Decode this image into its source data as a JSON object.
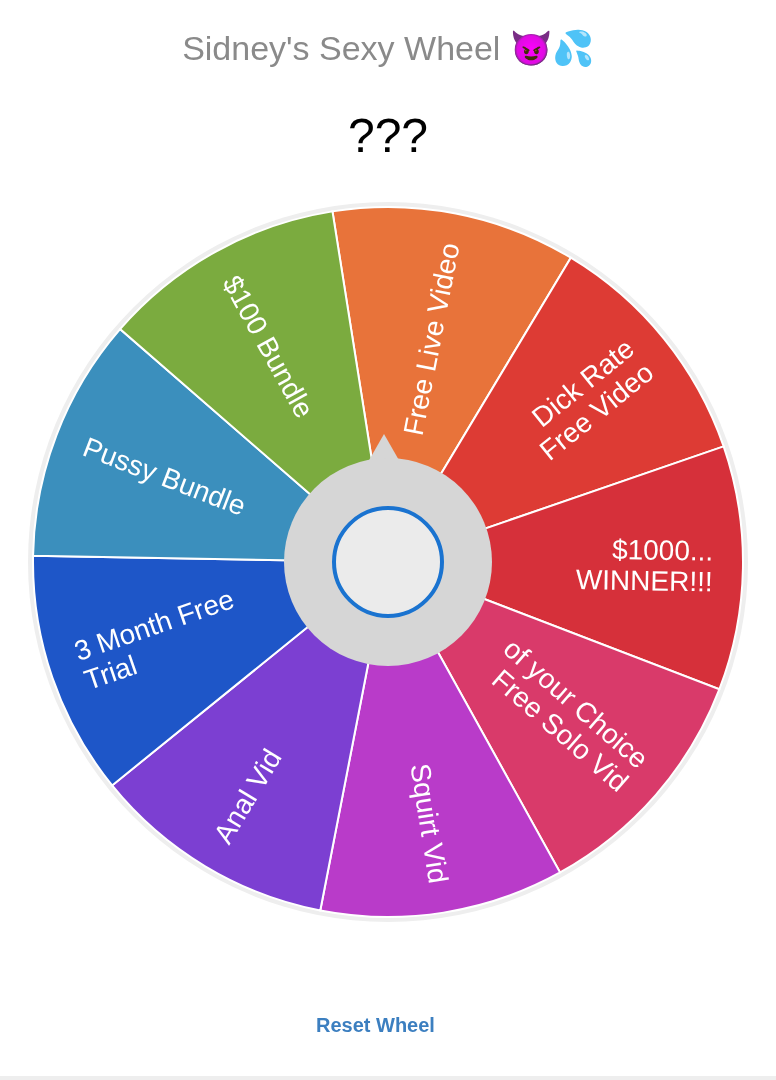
{
  "title": "Sidney's Sexy Wheel 😈💦",
  "result": "???",
  "wheel": {
    "segments": [
      {
        "lines": [
          "Free Live Video"
        ],
        "color": "#e8733a"
      },
      {
        "lines": [
          "Dick Rate",
          "Free Video"
        ],
        "color": "#dd3b34"
      },
      {
        "lines": [
          "$1000...",
          "WINNER!!!"
        ],
        "color": "#d6303a"
      },
      {
        "lines": [
          "of your Choice",
          "Free Solo Vid"
        ],
        "color": "#d93a6a"
      },
      {
        "lines": [
          "Squirt Vid"
        ],
        "color": "#b93bc9"
      },
      {
        "lines": [
          "Anal Vid"
        ],
        "color": "#7c3fd2"
      },
      {
        "lines": [
          "3 Month Free",
          "Trial"
        ],
        "color": "#1e56c8"
      },
      {
        "lines": [
          "Pussy Bundle"
        ],
        "color": "#3b8fbd"
      },
      {
        "lines": [
          "$100 Bundle"
        ],
        "color": "#7bab3f"
      }
    ]
  },
  "reset_link": "Reset Wheel"
}
